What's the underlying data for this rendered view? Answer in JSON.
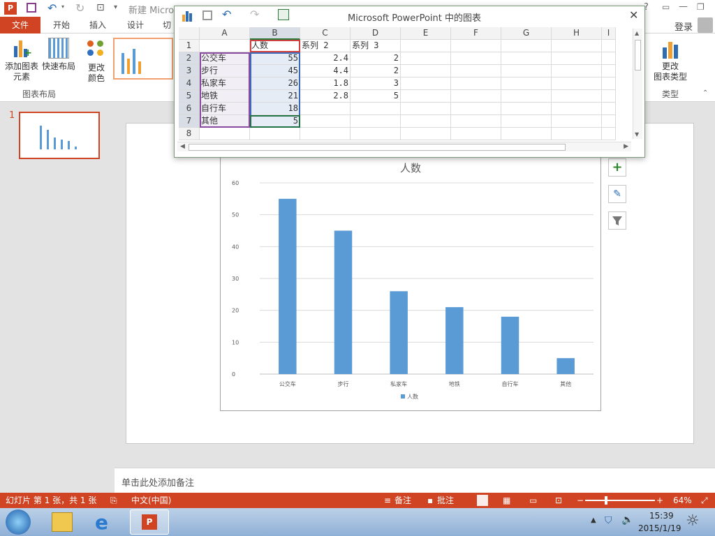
{
  "app": {
    "doc_title": "新建 Micros",
    "tabs": [
      "文件",
      "开始",
      "插入",
      "设计",
      "切"
    ],
    "account": "登录"
  },
  "ribbon": {
    "add_element": "添加图表\n元素",
    "quick_layout": "快速布局",
    "change_color": "更改\n颜色",
    "group_layout": "图表布局",
    "change_type": "更改\n图表类型",
    "group_type": "类型"
  },
  "excel": {
    "title": "Microsoft PowerPoint 中的图表",
    "col_headers": [
      "A",
      "B",
      "C",
      "D",
      "E",
      "F",
      "G",
      "H",
      "I"
    ],
    "row_headers": [
      "1",
      "2",
      "3",
      "4",
      "5",
      "6",
      "7",
      "8"
    ],
    "rows": [
      [
        "",
        "人数",
        "系列 2",
        "系列 3"
      ],
      [
        "公交车",
        "55",
        "2.4",
        "2"
      ],
      [
        "步行",
        "45",
        "4.4",
        "2"
      ],
      [
        "私家车",
        "26",
        "1.8",
        "3"
      ],
      [
        "地铁",
        "21",
        "2.8",
        "5"
      ],
      [
        "自行车",
        "18",
        "",
        ""
      ],
      [
        "其他",
        "5",
        "",
        ""
      ],
      [
        "",
        "",
        "",
        ""
      ]
    ]
  },
  "slide_panel": {
    "number": "1"
  },
  "chart_data": {
    "type": "bar",
    "title": "人数",
    "categories": [
      "公交车",
      "步行",
      "私家车",
      "地铁",
      "自行车",
      "其他"
    ],
    "series": [
      {
        "name": "人数",
        "values": [
          55,
          45,
          26,
          21,
          18,
          5
        ],
        "color": "#5b9bd5"
      }
    ],
    "ylim": [
      0,
      60
    ],
    "yticks": [
      "0",
      "10",
      "20",
      "30",
      "40",
      "50",
      "60"
    ],
    "grid": true,
    "legend": "bottom"
  },
  "notes": {
    "placeholder": "单击此处添加备注"
  },
  "status": {
    "slide_info": "幻灯片 第 1 张，共 1 张",
    "language": "中文(中国)",
    "notes_btn": "备注",
    "comments_btn": "批注",
    "zoom": "64%"
  },
  "taskbar": {
    "time": "15:39",
    "date": "2015/1/19"
  },
  "colors": {
    "accent": "#d04423",
    "bar": "#5b9bd5"
  }
}
